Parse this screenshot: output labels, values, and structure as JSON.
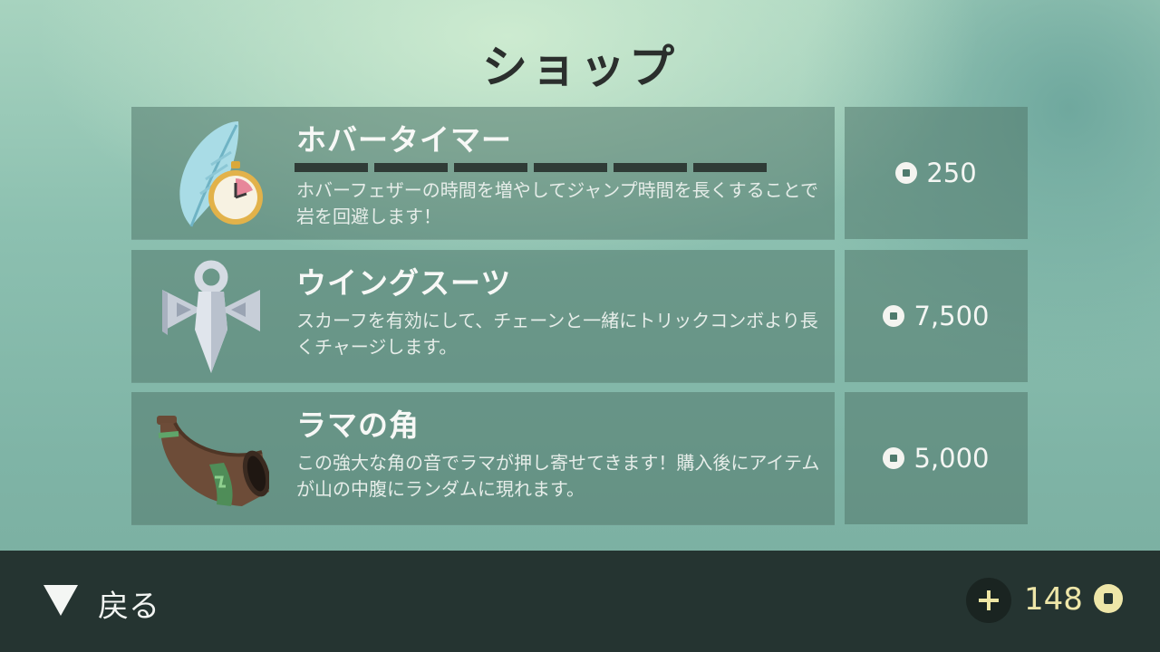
{
  "screen": {
    "title": "ショップ"
  },
  "items": [
    {
      "name": "ホバータイマー",
      "description": "ホバーフェザーの時間を増やしてジャンプ時間を長くすることで岩を回避します！",
      "price": "250",
      "icon": "feather-stopwatch-icon",
      "upgrade_levels_total": 6,
      "upgrade_levels_filled": 6
    },
    {
      "name": "ウイングスーツ",
      "description": "スカーフを有効にして、チェーンと一緒にトリックコンボより長くチャージします。",
      "price": "7,500",
      "icon": "wingsuit-icon"
    },
    {
      "name": "ラマの角",
      "description": "この強大な角の音でラマが押し寄せてきます！購入後にアイテムが山の中腹にランダムに現れます。",
      "price": "5,000",
      "icon": "llama-horn-icon"
    }
  ],
  "footer": {
    "back_label": "戻る",
    "back_icon": "triangle-down-icon",
    "add_coins_icon": "plus-icon",
    "coin_balance": "148",
    "coin_icon": "coin-icon"
  },
  "colors": {
    "accent_coin": "#eee6a8",
    "footer_bg": "#253431",
    "card_bg": "#52786c"
  }
}
